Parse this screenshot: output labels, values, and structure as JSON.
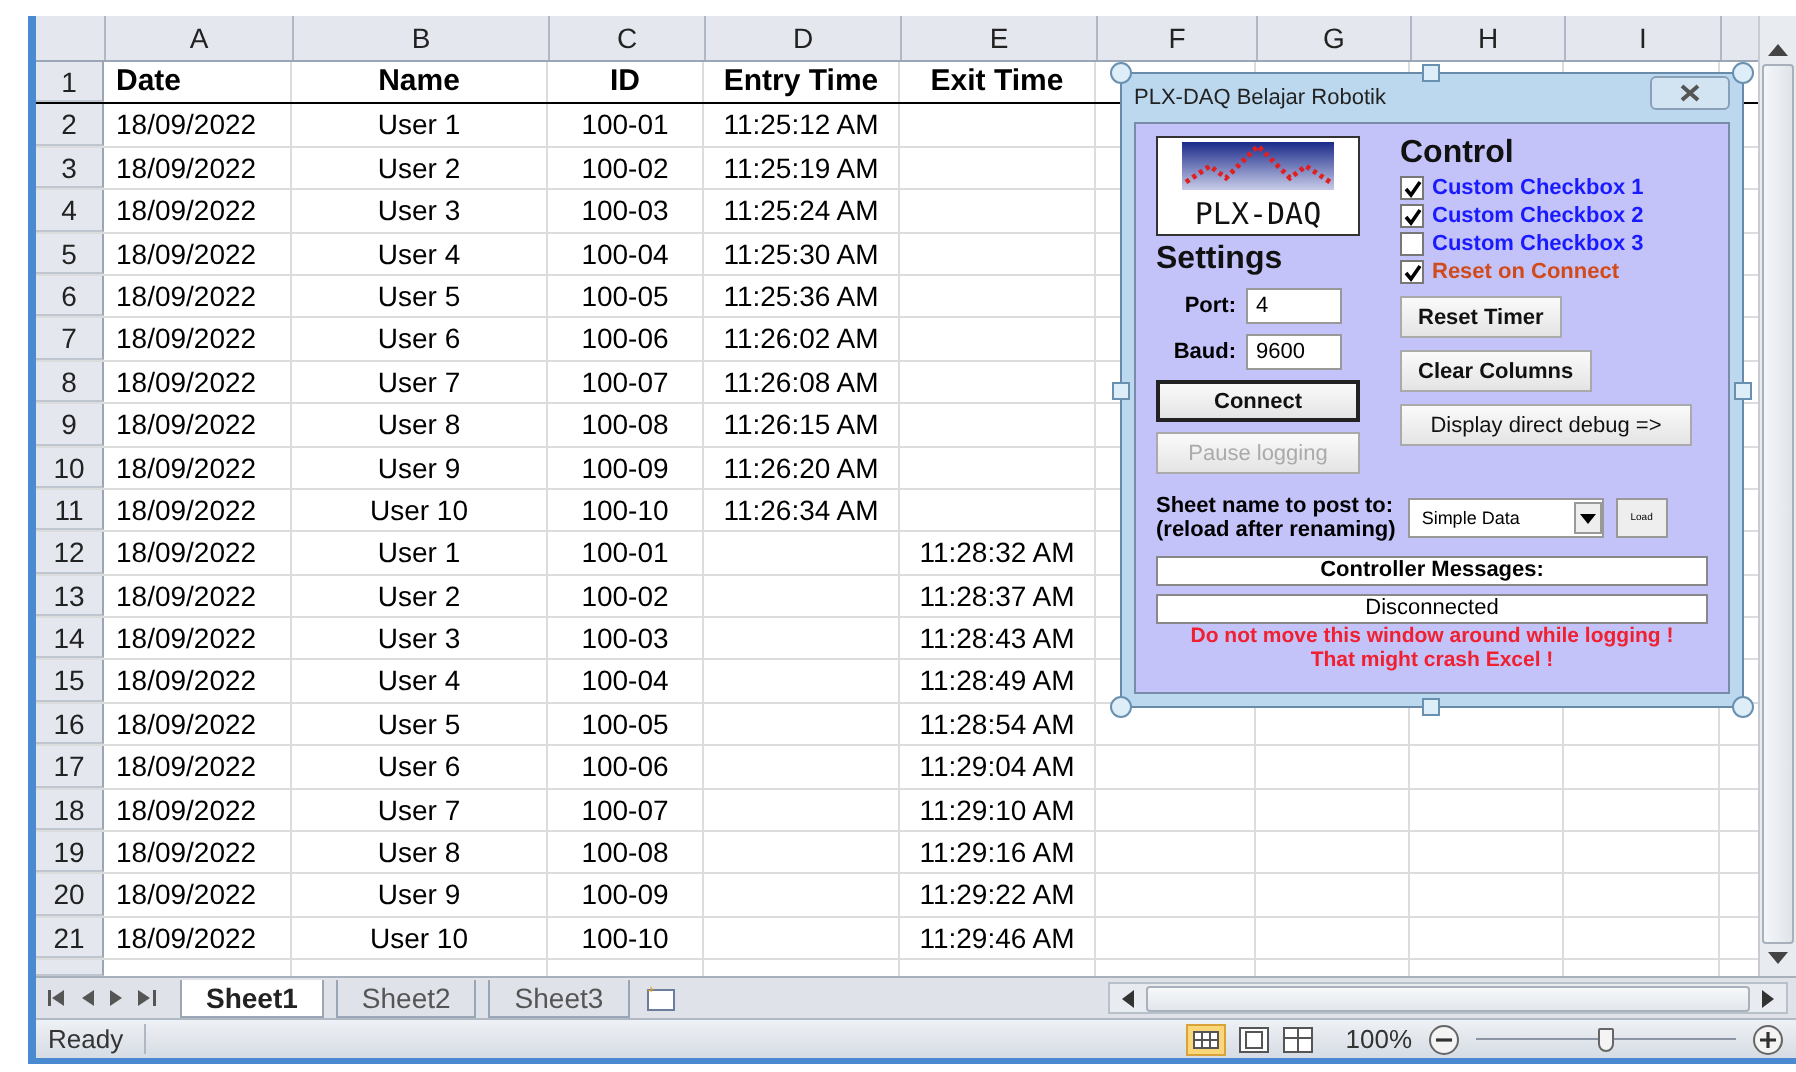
{
  "sheet": {
    "columns": [
      "A",
      "B",
      "C",
      "D",
      "E",
      "F",
      "G",
      "H",
      "I"
    ],
    "rows": [
      {
        "num": "1",
        "cells": [
          "Date",
          "Name",
          "ID",
          "Entry Time",
          "Exit Time"
        ],
        "kind": "header"
      },
      {
        "num": "2",
        "cells": [
          "18/09/2022",
          "User 1",
          "100-01",
          "11:25:12 AM",
          ""
        ],
        "kind": "data"
      },
      {
        "num": "3",
        "cells": [
          "18/09/2022",
          "User 2",
          "100-02",
          "11:25:19 AM",
          ""
        ],
        "kind": "data"
      },
      {
        "num": "4",
        "cells": [
          "18/09/2022",
          "User 3",
          "100-03",
          "11:25:24 AM",
          ""
        ],
        "kind": "data"
      },
      {
        "num": "5",
        "cells": [
          "18/09/2022",
          "User 4",
          "100-04",
          "11:25:30 AM",
          ""
        ],
        "kind": "data"
      },
      {
        "num": "6",
        "cells": [
          "18/09/2022",
          "User 5",
          "100-05",
          "11:25:36 AM",
          ""
        ],
        "kind": "data"
      },
      {
        "num": "7",
        "cells": [
          "18/09/2022",
          "User 6",
          "100-06",
          "11:26:02 AM",
          ""
        ],
        "kind": "data"
      },
      {
        "num": "8",
        "cells": [
          "18/09/2022",
          "User 7",
          "100-07",
          "11:26:08 AM",
          ""
        ],
        "kind": "data"
      },
      {
        "num": "9",
        "cells": [
          "18/09/2022",
          "User 8",
          "100-08",
          "11:26:15 AM",
          ""
        ],
        "kind": "data"
      },
      {
        "num": "10",
        "cells": [
          "18/09/2022",
          "User 9",
          "100-09",
          "11:26:20 AM",
          ""
        ],
        "kind": "data"
      },
      {
        "num": "11",
        "cells": [
          "18/09/2022",
          "User 10",
          "100-10",
          "11:26:34 AM",
          ""
        ],
        "kind": "data"
      },
      {
        "num": "12",
        "cells": [
          "18/09/2022",
          "User 1",
          "100-01",
          "",
          "11:28:32 AM"
        ],
        "kind": "data"
      },
      {
        "num": "13",
        "cells": [
          "18/09/2022",
          "User 2",
          "100-02",
          "",
          "11:28:37 AM"
        ],
        "kind": "data"
      },
      {
        "num": "14",
        "cells": [
          "18/09/2022",
          "User 3",
          "100-03",
          "",
          "11:28:43 AM"
        ],
        "kind": "data"
      },
      {
        "num": "15",
        "cells": [
          "18/09/2022",
          "User 4",
          "100-04",
          "",
          "11:28:49 AM"
        ],
        "kind": "data"
      },
      {
        "num": "16",
        "cells": [
          "18/09/2022",
          "User 5",
          "100-05",
          "",
          "11:28:54 AM"
        ],
        "kind": "data"
      },
      {
        "num": "17",
        "cells": [
          "18/09/2022",
          "User 6",
          "100-06",
          "",
          "11:29:04 AM"
        ],
        "kind": "data"
      },
      {
        "num": "18",
        "cells": [
          "18/09/2022",
          "User 7",
          "100-07",
          "",
          "11:29:10 AM"
        ],
        "kind": "data"
      },
      {
        "num": "19",
        "cells": [
          "18/09/2022",
          "User 8",
          "100-08",
          "",
          "11:29:16 AM"
        ],
        "kind": "data"
      },
      {
        "num": "20",
        "cells": [
          "18/09/2022",
          "User 9",
          "100-09",
          "",
          "11:29:22 AM"
        ],
        "kind": "data"
      },
      {
        "num": "21",
        "cells": [
          "18/09/2022",
          "User 10",
          "100-10",
          "",
          "11:29:46 AM"
        ],
        "kind": "data"
      }
    ]
  },
  "dialog": {
    "title": "PLX-DAQ Belajar Robotik",
    "logo_text": "PLX-DAQ",
    "settings_heading": "Settings",
    "port_label": "Port:",
    "port_value": "4",
    "baud_label": "Baud:",
    "baud_value": "9600",
    "control_heading": "Control",
    "checkboxes": [
      {
        "label": "Custom Checkbox 1",
        "checked": true,
        "color": "#1a1aff"
      },
      {
        "label": "Custom Checkbox 2",
        "checked": true,
        "color": "#1a1aff"
      },
      {
        "label": "Custom Checkbox 3",
        "checked": false,
        "color": "#1a1aff"
      },
      {
        "label": "Reset on Connect",
        "checked": true,
        "color": "#d04a1a"
      }
    ],
    "buttons": [
      {
        "label": "Reset Timer",
        "disabled": false,
        "default": false
      },
      {
        "label": "Connect",
        "disabled": false,
        "default": true
      },
      {
        "label": "Clear Columns",
        "disabled": false,
        "default": false
      },
      {
        "label": "Pause logging",
        "disabled": true,
        "default": false
      },
      {
        "label": "Display direct debug =>",
        "disabled": false,
        "default": false
      }
    ],
    "sheet_label_1": "Sheet name to post to:",
    "sheet_label_2": "(reload after renaming)",
    "sheet_select": "Simple Data",
    "load_button": "Load",
    "messages_heading": "Controller Messages:",
    "message": "Disconnected",
    "warning_1": "Do not move this window around while logging !",
    "warning_2": "That might crash Excel !"
  },
  "tabs": [
    {
      "label": "Sheet1",
      "selected": true
    },
    {
      "label": "Sheet2",
      "selected": false
    },
    {
      "label": "Sheet3",
      "selected": false
    }
  ],
  "status": {
    "text": "Ready",
    "zoom": "100%",
    "zoom_slider": {
      "level": 0.5
    }
  }
}
